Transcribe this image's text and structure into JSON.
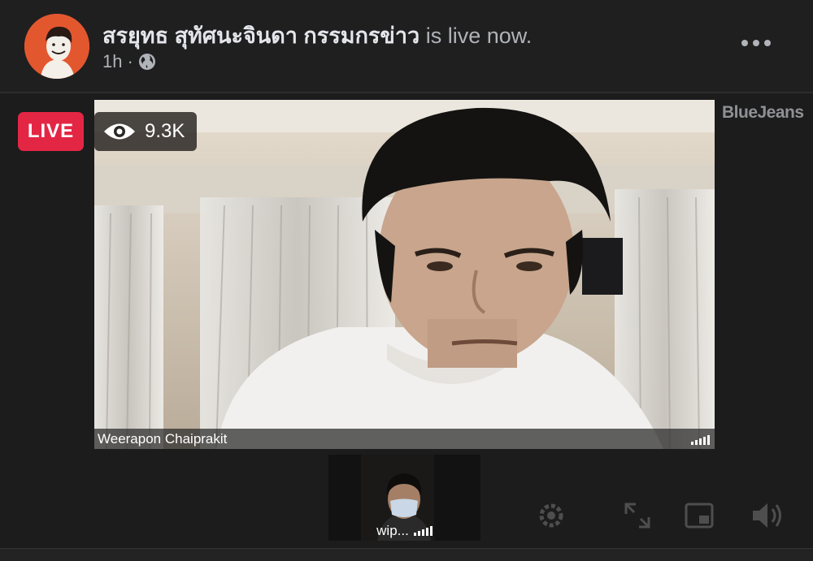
{
  "post": {
    "author": "สรยุทธ สุทัศนะจินดา กรรมกรข่าว",
    "status_suffix": " is live now.",
    "time": "1h",
    "separator": "·"
  },
  "live": {
    "badge": "LIVE",
    "viewer_count": "9.3K"
  },
  "video": {
    "main_participant": "Weerapon Chaiprakit",
    "thumbnail_participant": "wip...",
    "brand": "BlueJeans"
  },
  "icons": {
    "more": "more-horizontal-icon",
    "audience": "globe-icon",
    "viewers": "eye-icon",
    "signal": "signal-strength-icon",
    "settings": "gear-icon",
    "fullscreen": "expand-icon",
    "pip": "picture-in-picture-icon",
    "volume": "speaker-icon"
  },
  "colors": {
    "background": "#1f1f20",
    "live_red": "#e42645",
    "text_primary": "#e4e6eb",
    "text_secondary": "#b0b3b8"
  }
}
